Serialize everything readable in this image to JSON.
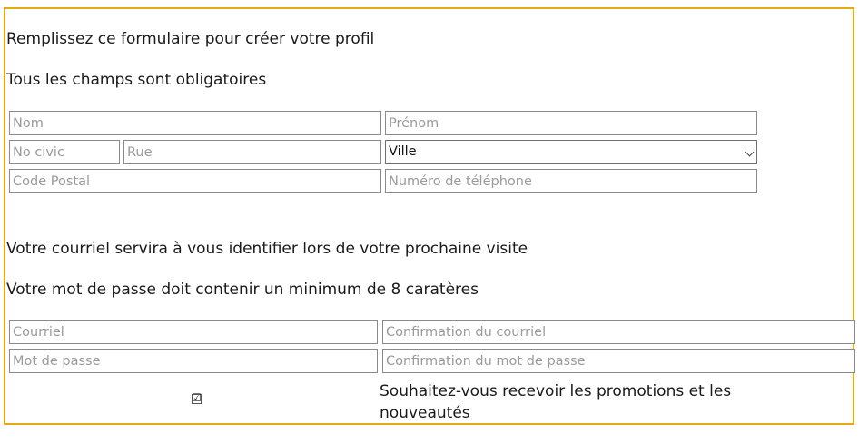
{
  "intro": {
    "line1": "Remplissez ce formulaire pour créer votre profil",
    "line2": "Tous les champs sont obligatoires"
  },
  "address_form": {
    "nom_placeholder": "Nom",
    "prenom_placeholder": "Prénom",
    "no_civic_placeholder": "No civic",
    "rue_placeholder": "Rue",
    "ville_selected": "Ville",
    "code_postal_placeholder": "Code Postal",
    "telephone_placeholder": "Numéro de téléphone"
  },
  "account_info": {
    "line1": "Votre courriel servira à vous identifier lors de votre prochaine visite",
    "line2": "Votre mot de passe doit contenir un minimum de 8 caratères"
  },
  "account_form": {
    "courriel_placeholder": "Courriel",
    "confirm_courriel_placeholder": "Confirmation du courriel",
    "mot_de_passe_placeholder": "Mot de passe",
    "confirm_mot_de_passe_placeholder": "Confirmation du mot de passe"
  },
  "promotions": {
    "checked": true,
    "checkbox_glyph": "☑",
    "label": "Souhaitez-vous recevoir les promotions et les nouveautés"
  },
  "colors": {
    "frame_border": "#e6a817",
    "field_border": "#8a8a8a",
    "placeholder": "#9a9a9a"
  }
}
